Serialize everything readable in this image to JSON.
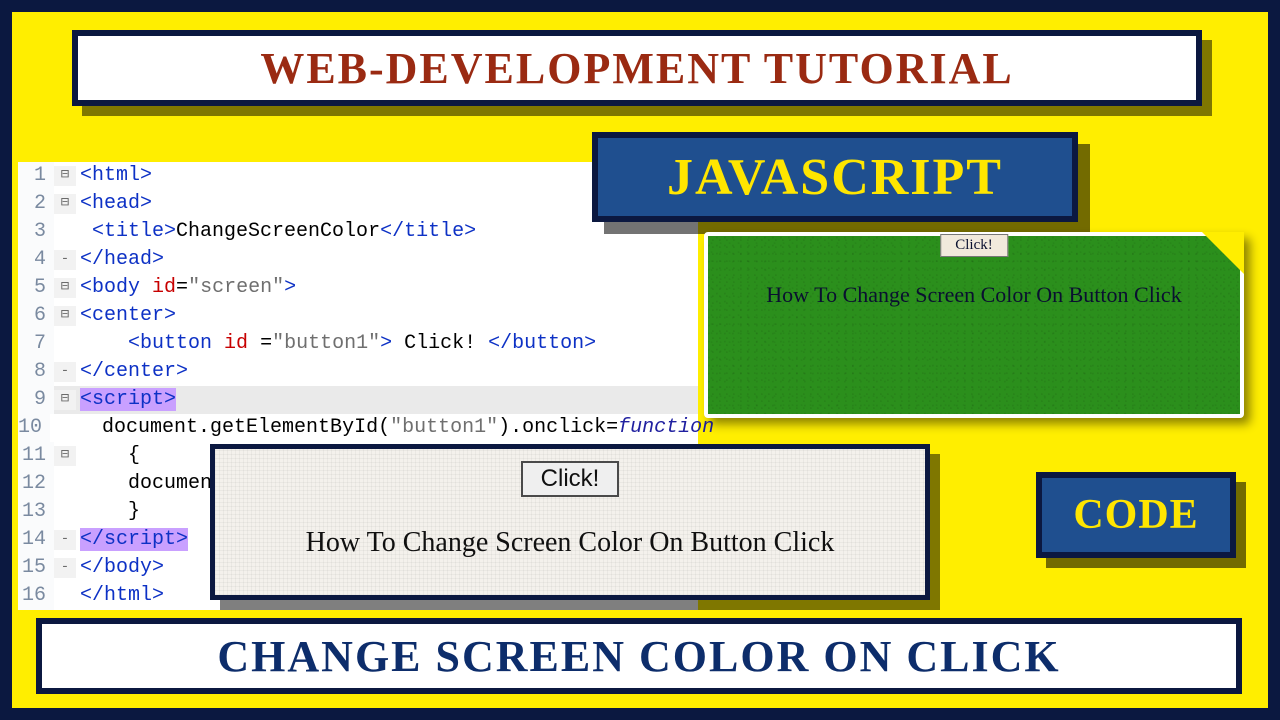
{
  "banners": {
    "top": "WEB-DEVELOPMENT TUTORIAL",
    "js": "JAVASCRIPT",
    "code": "CODE",
    "bottom": "CHANGE SCREEN COLOR ON CLICK"
  },
  "previews": {
    "green": {
      "button": "Click!",
      "caption": "How To Change Screen Color On Button Click"
    },
    "white": {
      "button": "Click!",
      "caption": "How To Change Screen Color On Button Click"
    }
  },
  "code": {
    "lines": [
      {
        "n": "1",
        "fold": "⊟",
        "html": "<span class='tag'>&lt;html&gt;</span>"
      },
      {
        "n": "2",
        "fold": "⊟",
        "html": "<span class='tag'>&lt;head&gt;</span>"
      },
      {
        "n": "3",
        "fold": " ",
        "html": " <span class='tag'>&lt;title&gt;</span>ChangeScreenColor<span class='tag'>&lt;/title&gt;</span>"
      },
      {
        "n": "4",
        "fold": "-",
        "html": "<span class='tag'>&lt;/head&gt;</span>"
      },
      {
        "n": "5",
        "fold": "⊟",
        "html": "<span class='tag'>&lt;body</span> <span class='attr'>id</span>=<span class='str'>\"screen\"</span><span class='tag'>&gt;</span>"
      },
      {
        "n": "6",
        "fold": "⊟",
        "html": "<span class='tag'>&lt;center&gt;</span>"
      },
      {
        "n": "7",
        "fold": " ",
        "html": "    <span class='tag'>&lt;button</span> <span class='attr'>id</span> =<span class='str'>\"button1\"</span><span class='tag'>&gt;</span> Click! <span class='tag'>&lt;/button&gt;</span>"
      },
      {
        "n": "8",
        "fold": "-",
        "html": "<span class='tag'>&lt;/center&gt;</span>"
      },
      {
        "n": "9",
        "fold": "⊟",
        "html": "<span class='hl tag'>&lt;script&gt;</span>",
        "rowhl": true
      },
      {
        "n": "10",
        "fold": " ",
        "html": "    document.getElementById(<span class='str'>\"button1\"</span>).onclick=<span class='kw'>function</span>"
      },
      {
        "n": "11",
        "fold": "⊟",
        "html": "    {"
      },
      {
        "n": "12",
        "fold": " ",
        "html": "    documen"
      },
      {
        "n": "13",
        "fold": " ",
        "html": "    }"
      },
      {
        "n": "14",
        "fold": "-",
        "html": "<span class='hl tag'>&lt;/script&gt;</span>"
      },
      {
        "n": "15",
        "fold": "-",
        "html": "<span class='tag'>&lt;/body&gt;</span>"
      },
      {
        "n": "16",
        "fold": " ",
        "html": "<span class='tag'>&lt;/html&gt;</span>"
      }
    ]
  }
}
